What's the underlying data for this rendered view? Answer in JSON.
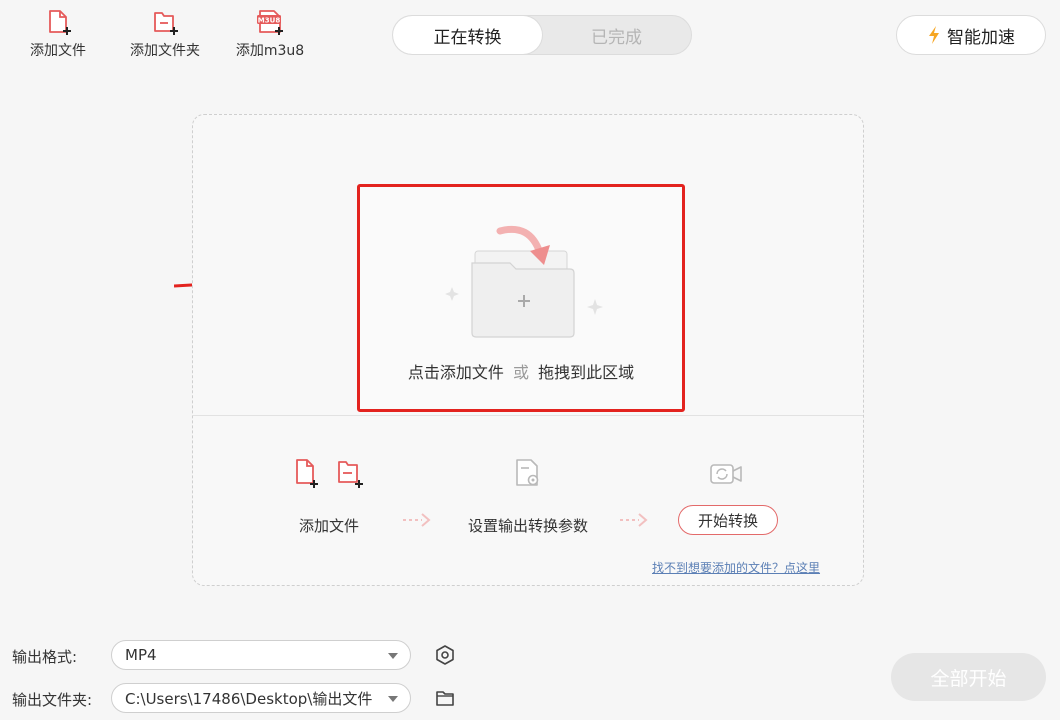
{
  "toolbar": {
    "add_file": "添加文件",
    "add_folder": "添加文件夹",
    "add_m3u8": "添加m3u8",
    "m3u8_badge": "M3U8"
  },
  "tabs": [
    {
      "label": "正在转换",
      "active": true
    },
    {
      "label": "已完成",
      "active": false
    }
  ],
  "speed_button": {
    "label": "智能加速",
    "icon": "lightning-icon"
  },
  "drop_zone": {
    "text_main": "点击添加文件",
    "text_or": "或",
    "text_drag": "拖拽到此区域"
  },
  "steps": {
    "step1": "添加文件",
    "step2": "设置输出转换参数",
    "step3": "开始转换",
    "help_link": "找不到想要添加的文件？点这里"
  },
  "output": {
    "format_label": "输出格式:",
    "format_value": "MP4",
    "folder_label": "输出文件夹:",
    "folder_value": "C:\\Users\\17486\\Desktop\\输出文件"
  },
  "start_all": "全部开始",
  "colors": {
    "accent": "#e55a5a",
    "highlight_box": "#e3231f",
    "link": "#5b7fb5",
    "bolt": "#f6a623"
  }
}
